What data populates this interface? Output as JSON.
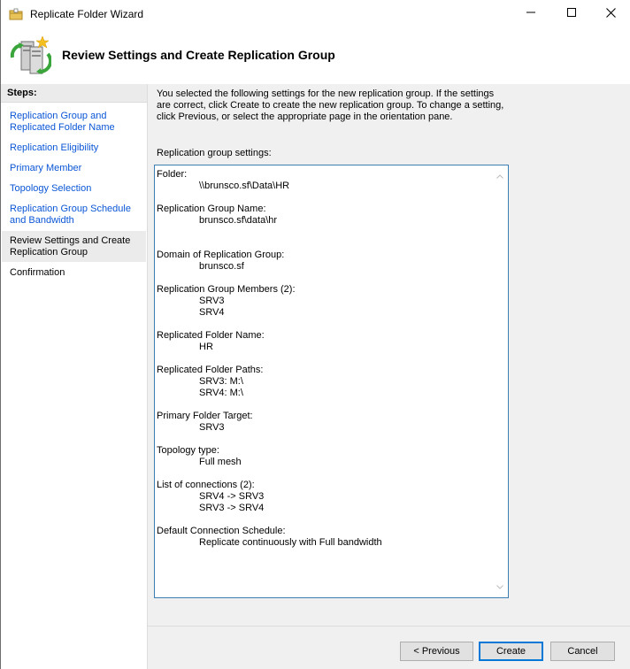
{
  "window": {
    "title": "Replicate Folder Wizard",
    "controls": {
      "minimize_icon": "minimize-icon",
      "maximize_icon": "maximize-icon",
      "close_icon": "close-icon"
    }
  },
  "header": {
    "title": "Review Settings and Create Replication Group"
  },
  "sidebar": {
    "title": "Steps:",
    "items": [
      {
        "label": "Replication Group and Replicated Folder Name"
      },
      {
        "label": "Replication Eligibility"
      },
      {
        "label": "Primary Member"
      },
      {
        "label": "Topology Selection"
      },
      {
        "label": "Replication Group Schedule and Bandwidth"
      },
      {
        "label": "Review Settings and Create Replication Group"
      },
      {
        "label": "Confirmation"
      }
    ]
  },
  "main": {
    "intro": "You selected the following settings for the new replication group. If the settings are correct, click Create to create the new replication group. To change a setting, click Previous, or select the appropriate page in the orientation pane.",
    "settings_label": "Replication group settings:",
    "settings": [
      {
        "label": "Folder:",
        "values": [
          "\\\\brunsco.sf\\Data\\HR"
        ]
      },
      {
        "label": "Replication Group Name:",
        "values": [
          "brunsco.sf\\data\\hr"
        ]
      },
      {
        "label": "Domain of Replication Group:",
        "values": [
          "brunsco.sf"
        ]
      },
      {
        "label": "Replication Group Members (2):",
        "values": [
          "SRV3",
          "SRV4"
        ]
      },
      {
        "label": "Replicated Folder Name:",
        "values": [
          "HR"
        ]
      },
      {
        "label": "Replicated Folder Paths:",
        "values": [
          "SRV3: M:\\",
          "SRV4: M:\\"
        ]
      },
      {
        "label": "Primary Folder Target:",
        "values": [
          "SRV3"
        ]
      },
      {
        "label": "Topology type:",
        "values": [
          "Full mesh"
        ]
      },
      {
        "label": "List of connections (2):",
        "values": [
          "SRV4 -> SRV3",
          "SRV3 -> SRV4"
        ]
      },
      {
        "label": "Default Connection Schedule:",
        "values": [
          "Replicate continuously with Full bandwidth"
        ]
      }
    ]
  },
  "buttons": {
    "previous": "< Previous",
    "create": "Create",
    "cancel": "Cancel"
  },
  "colors": {
    "link": "#0b56d6",
    "selected_bg": "#ebebeb",
    "focus_border": "#3c7fb1",
    "default_button_border": "#0078d7"
  }
}
